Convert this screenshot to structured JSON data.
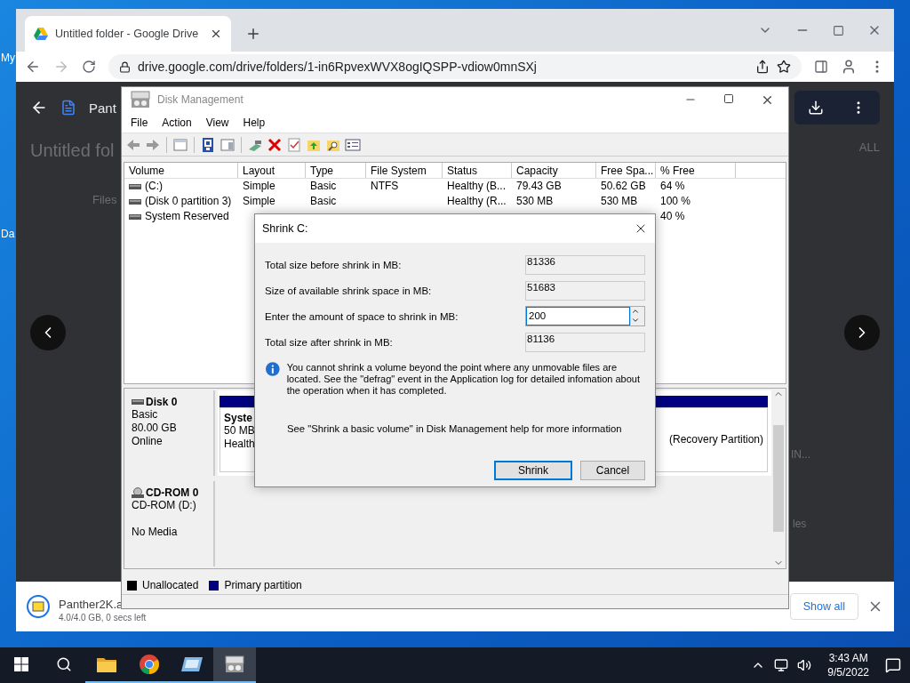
{
  "desktop_labels": [
    "My",
    "Da"
  ],
  "browser": {
    "tab_title": "Untitled folder - Google Drive",
    "url": "drive.google.com/drive/folders/1-in6RpvexWVX8ogIQSPP-vdiow0mnSXj"
  },
  "drive": {
    "file_name": "Pant",
    "folder_title": "Untitled fol",
    "files_label": "Files",
    "select_all": "ALL",
    "item_fragment": "IN...",
    "side_fragment": "les"
  },
  "download_bar": {
    "file_name": "Panther2K.a",
    "progress": "4.0/4.0 GB, 0 secs left",
    "show_all": "Show all"
  },
  "disk_management": {
    "title": "Disk Management",
    "menu": [
      "File",
      "Action",
      "View",
      "Help"
    ],
    "columns": [
      "Volume",
      "Layout",
      "Type",
      "File System",
      "Status",
      "Capacity",
      "Free Spa...",
      "% Free"
    ],
    "rows": [
      {
        "cells": [
          "(C:)",
          "Simple",
          "Basic",
          "NTFS",
          "Healthy (B...",
          "79.43 GB",
          "50.62 GB",
          "64 %"
        ]
      },
      {
        "cells": [
          "(Disk 0 partition 3)",
          "Simple",
          "Basic",
          null,
          "Healthy (R...",
          "530 MB",
          "530 MB",
          "100 %"
        ]
      },
      {
        "cells": [
          "System Reserved",
          null,
          null,
          null,
          null,
          null,
          null,
          "40 %"
        ]
      }
    ],
    "disks": [
      {
        "kind": "disk",
        "name": "Disk 0",
        "type": "Basic",
        "size": "80.00 GB",
        "status": "Online",
        "partitions": [
          {
            "name": "Syste",
            "lines": [
              "50 MB",
              "Health"
            ]
          },
          {
            "lines": [
              "(Recovery Partition)"
            ]
          }
        ]
      },
      {
        "kind": "cdrom",
        "name": "CD-ROM 0",
        "type": "CD-ROM (D:)",
        "status": "No Media"
      }
    ],
    "legend": [
      {
        "label": "Unallocated",
        "color": "#000000"
      },
      {
        "label": "Primary partition",
        "color": "#000080"
      }
    ]
  },
  "dialog": {
    "title": "Shrink C:",
    "fields": [
      {
        "label": "Total size before shrink in MB:",
        "value": "81336",
        "kind": "readonly"
      },
      {
        "label": "Size of available shrink space in MB:",
        "value": "51683",
        "kind": "readonly"
      },
      {
        "label": "Enter the amount of space to shrink in MB:",
        "value": "200",
        "kind": "spin"
      },
      {
        "label": "Total size after shrink in MB:",
        "value": "81136",
        "kind": "readonly"
      }
    ],
    "info": "You cannot shrink a volume beyond the point where any unmovable files are located. See the \"defrag\" event in the Application log for detailed infomation about the operation when it has completed.",
    "help": "See \"Shrink a basic volume\" in Disk Management help for more information",
    "buttons": [
      {
        "label": "Shrink",
        "default": true
      },
      {
        "label": "Cancel",
        "default": false
      }
    ]
  },
  "taskbar": {
    "apps": [
      {
        "kind": "folder",
        "running": true,
        "selected": false
      },
      {
        "kind": "chrome",
        "running": true,
        "selected": false
      },
      {
        "kind": "app",
        "running": true,
        "selected": false
      },
      {
        "kind": "disk",
        "running": true,
        "selected": true
      }
    ],
    "time": "3:43 AM",
    "date": "9/5/2022"
  }
}
